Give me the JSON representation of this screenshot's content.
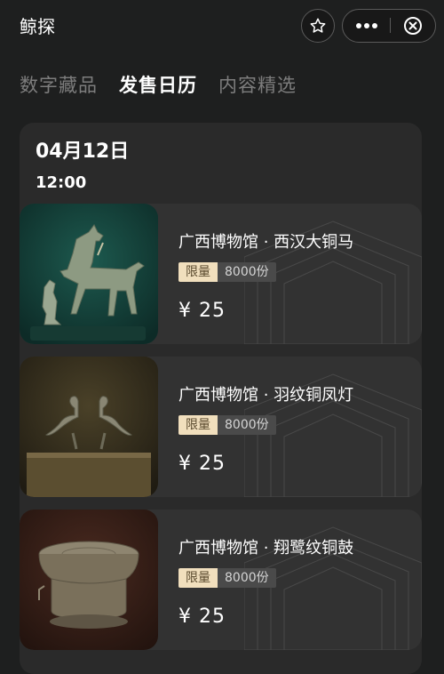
{
  "app": {
    "title": "鲸探"
  },
  "tabs": [
    {
      "label": "数字藏品",
      "active": false
    },
    {
      "label": "发售日历",
      "active": true
    },
    {
      "label": "内容精选",
      "active": false
    }
  ],
  "calendar": {
    "date": "04月12日",
    "time": "12:00",
    "items": [
      {
        "name": "广西博物馆 · 西汉大铜马",
        "limit_label": "限量",
        "count": "8000份",
        "price": "¥ 25",
        "thumb_icon": "bronze-horse"
      },
      {
        "name": "广西博物馆 · 羽纹铜凤灯",
        "limit_label": "限量",
        "count": "8000份",
        "price": "¥ 25",
        "thumb_icon": "bronze-phoenix-lamp"
      },
      {
        "name": "广西博物馆 · 翔鹭纹铜鼓",
        "limit_label": "限量",
        "count": "8000份",
        "price": "¥ 25",
        "thumb_icon": "bronze-drum"
      }
    ]
  },
  "colors": {
    "background": "#1e1f1f",
    "panel": "#2a2a2a",
    "card": "#323232",
    "badge_limit_bg": "#f1dfbd",
    "badge_count_bg": "#4a4a4a"
  }
}
